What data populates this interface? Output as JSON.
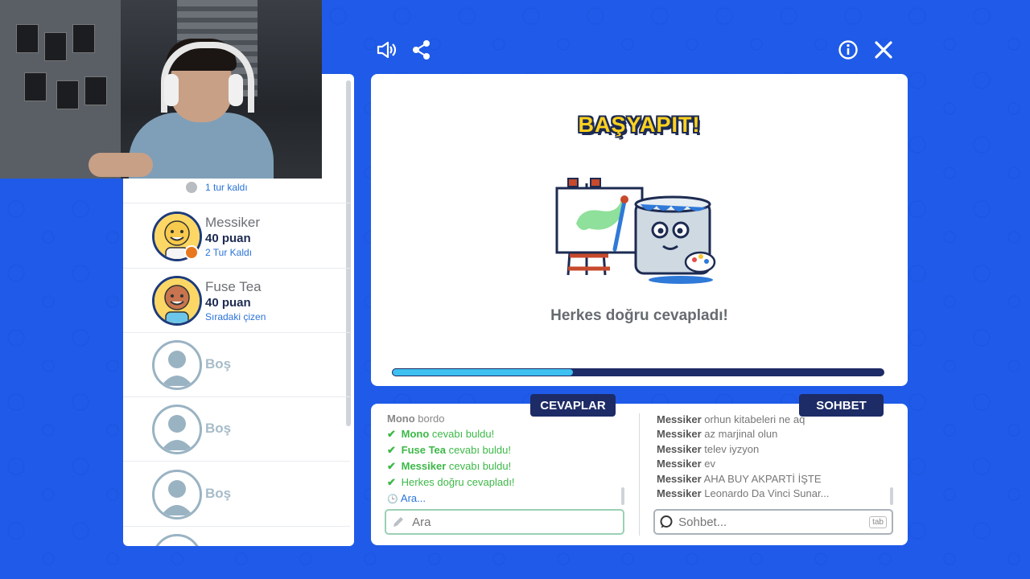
{
  "players": [
    {
      "name": "",
      "points": "",
      "status": "1 tur kaldı",
      "avatar": "orange-face-icon",
      "badge_color": "#b9bcc0"
    },
    {
      "name": "Messiker",
      "points": "40 puan",
      "status": "2 Tur Kaldı",
      "avatar": "yellow-face-icon",
      "badge_color": "#e8781e"
    },
    {
      "name": "Fuse Tea",
      "points": "40 puan",
      "status": "Sıradaki çizen",
      "avatar": "brown-face-icon",
      "badge_color": ""
    },
    {
      "name": "Boş"
    },
    {
      "name": "Boş"
    },
    {
      "name": "Boş"
    }
  ],
  "canvas": {
    "title": "BAŞYAPIT!",
    "caption": "Herkes doğru cevapladı!",
    "progress_fraction": 0.37,
    "illustration": "easel-paint-bucket-mascot"
  },
  "answers": {
    "tab_label": "CEVAPLAR",
    "lines": [
      {
        "prefix": "",
        "name": "Mono",
        "text": " bordo",
        "type": "grey"
      },
      {
        "prefix": "✔",
        "name": "Mono",
        "text": " cevabı buldu!",
        "type": "green"
      },
      {
        "prefix": "✔",
        "name": "Fuse Tea",
        "text": " cevabı buldu!",
        "type": "green"
      },
      {
        "prefix": "✔",
        "name": "Messiker",
        "text": " cevabı buldu!",
        "type": "green"
      },
      {
        "prefix": "✔",
        "name": "",
        "text": "Herkes doğru cevapladı!",
        "type": "green"
      },
      {
        "prefix": "🕒",
        "name": "",
        "text": "Ara...",
        "type": "blue"
      }
    ],
    "input_placeholder": "Ara"
  },
  "chat": {
    "tab_label": "SOHBET",
    "lines": [
      {
        "user": "Messiker",
        "text": "orhun kitabeleri ne aq"
      },
      {
        "user": "Messiker",
        "text": "az marjinal olun"
      },
      {
        "user": "Messiker",
        "text": "telev iyzyon"
      },
      {
        "user": "Messiker",
        "text": "ev"
      },
      {
        "user": "Messiker",
        "text": "AHA BUY AKPARTİ İŞTE"
      },
      {
        "user": "Messiker",
        "text": "Leonardo Da Vinci Sunar..."
      }
    ],
    "input_placeholder": "Sohbet...",
    "tab_hint": "tab"
  },
  "toolbar": {
    "icons": [
      "volume-icon",
      "share-icon",
      "info-icon",
      "close-icon"
    ]
  },
  "colors": {
    "background": "#1f5be8",
    "navy": "#1d2b66",
    "green": "#3db848",
    "title_yellow": "#ffd21e",
    "progress": "#3ec0f0"
  }
}
